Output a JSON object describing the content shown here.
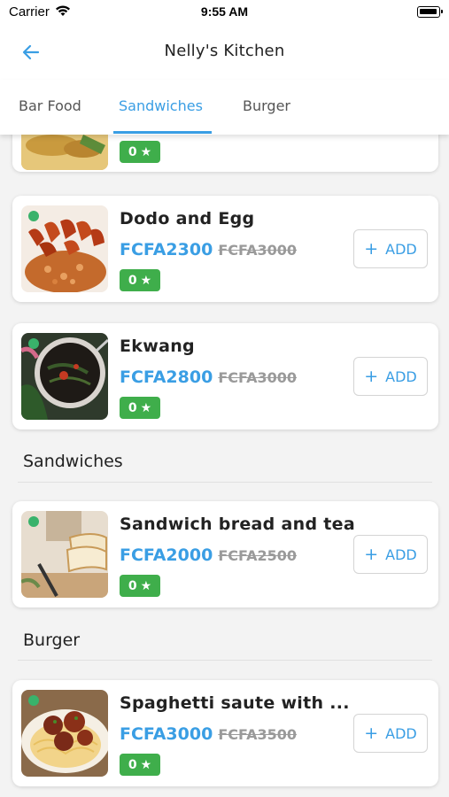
{
  "status_bar": {
    "carrier": "Carrier",
    "time": "9:55 AM"
  },
  "header": {
    "title": "Nelly's Kitchen"
  },
  "tabs": [
    {
      "label": "Bar Food"
    },
    {
      "label": "Sandwiches",
      "active": true
    },
    {
      "label": "Burger"
    }
  ],
  "colors": {
    "accent": "#3a9ee4",
    "rating_green": "#3fae4b",
    "availability_dot": "#39b26b"
  },
  "partial_item": {
    "rating": "0"
  },
  "items": [
    {
      "name": "Dodo and Egg",
      "price": "FCFA2300",
      "old_price": "FCFA3000",
      "rating": "0",
      "add_label": "ADD"
    },
    {
      "name": "Ekwang",
      "price": "FCFA2800",
      "old_price": "FCFA3000",
      "rating": "0",
      "add_label": "ADD"
    }
  ],
  "sections": [
    {
      "title": "Sandwiches",
      "items": [
        {
          "name": "Sandwich bread and tea",
          "price": "FCFA2000",
          "old_price": "FCFA2500",
          "rating": "0",
          "add_label": "ADD"
        }
      ]
    },
    {
      "title": "Burger",
      "items": [
        {
          "name": "Spaghetti saute with ...",
          "price": "FCFA3000",
          "old_price": "FCFA3500",
          "rating": "0",
          "add_label": "ADD"
        }
      ]
    }
  ],
  "icons": {
    "back": "arrow-left-icon",
    "wifi": "wifi-icon",
    "battery": "battery-icon",
    "star": "star-icon",
    "plus": "plus-icon"
  }
}
